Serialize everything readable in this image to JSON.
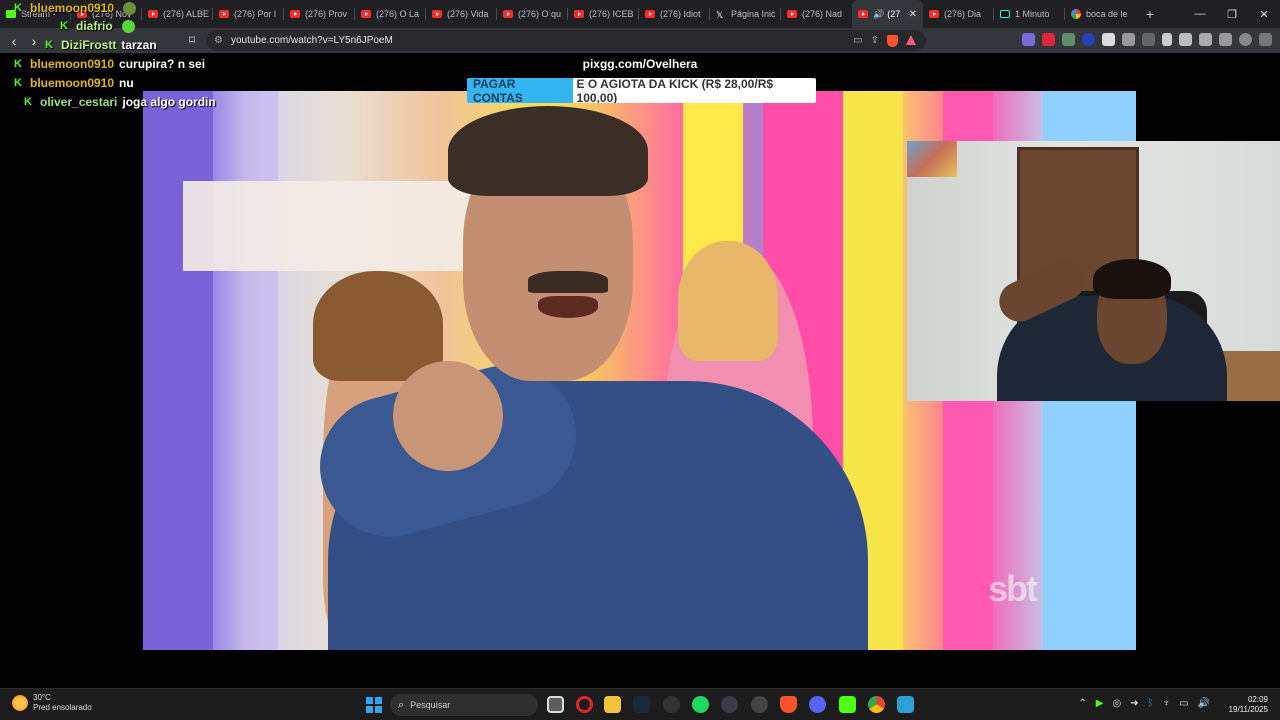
{
  "browser": {
    "tabs": [
      {
        "label": "Stream -",
        "icon": "kick-icon"
      },
      {
        "label": "(276) Nov",
        "icon": "youtube-icon"
      },
      {
        "label": "(276) ALBE",
        "icon": "youtube-icon"
      },
      {
        "label": "(276) Por l",
        "icon": "youtube-icon"
      },
      {
        "label": "(276) Prov",
        "icon": "youtube-icon"
      },
      {
        "label": "(276) O La",
        "icon": "youtube-icon"
      },
      {
        "label": "(276) Vida",
        "icon": "youtube-icon"
      },
      {
        "label": "(276) O qu",
        "icon": "youtube-icon"
      },
      {
        "label": "(276) ICEB",
        "icon": "youtube-icon"
      },
      {
        "label": "(276) Idiot",
        "icon": "youtube-icon"
      },
      {
        "label": "Página Inic",
        "icon": "x-icon"
      },
      {
        "label": "(276) Nad",
        "icon": "youtube-icon"
      },
      {
        "label": "(27",
        "icon": "youtube-icon",
        "active": true
      },
      {
        "label": "(276) Dia",
        "icon": "youtube-icon"
      },
      {
        "label": "1 Minuto",
        "icon": "tiktok-icon"
      },
      {
        "label": "boca de le",
        "icon": "google-icon"
      }
    ],
    "new_tab": "+",
    "url": "youtube.com/watch?v=LY5n6JPoeM",
    "window_controls": {
      "minimize": "—",
      "maximize": "❐",
      "close": "✕"
    }
  },
  "chat": [
    {
      "user": "bluemoon0910",
      "msg": "",
      "color": "#e6b800"
    },
    {
      "user": "diafrio",
      "msg": "",
      "color": "#b9f27c"
    },
    {
      "user": "DiziFrostt",
      "msg": "tarzan",
      "color": "#b9f27c"
    },
    {
      "user": "bluemoon0910",
      "msg": "curupira? n sei",
      "color": "#e6b800"
    },
    {
      "user": "bluemoon0910",
      "msg": "nu",
      "color": "#e6b800"
    },
    {
      "user": "oliver_cestari",
      "msg": "joga algo gordin",
      "color": "#9be37a"
    }
  ],
  "overlay": {
    "site": "pixgg.com/Ovelhera",
    "banner_highlight": "PAGAR CONTAS",
    "banner_rest": "E O AGIOTA DA KICK (R$ 28,00/R$ 100,00)"
  },
  "video": {
    "channel_logo": "sbt"
  },
  "taskbar": {
    "temperature": "30°C",
    "weather_desc": "Pred ensolarado",
    "search_placeholder": "Pesquisar",
    "time": "02:09",
    "date": "19/11/2025"
  }
}
